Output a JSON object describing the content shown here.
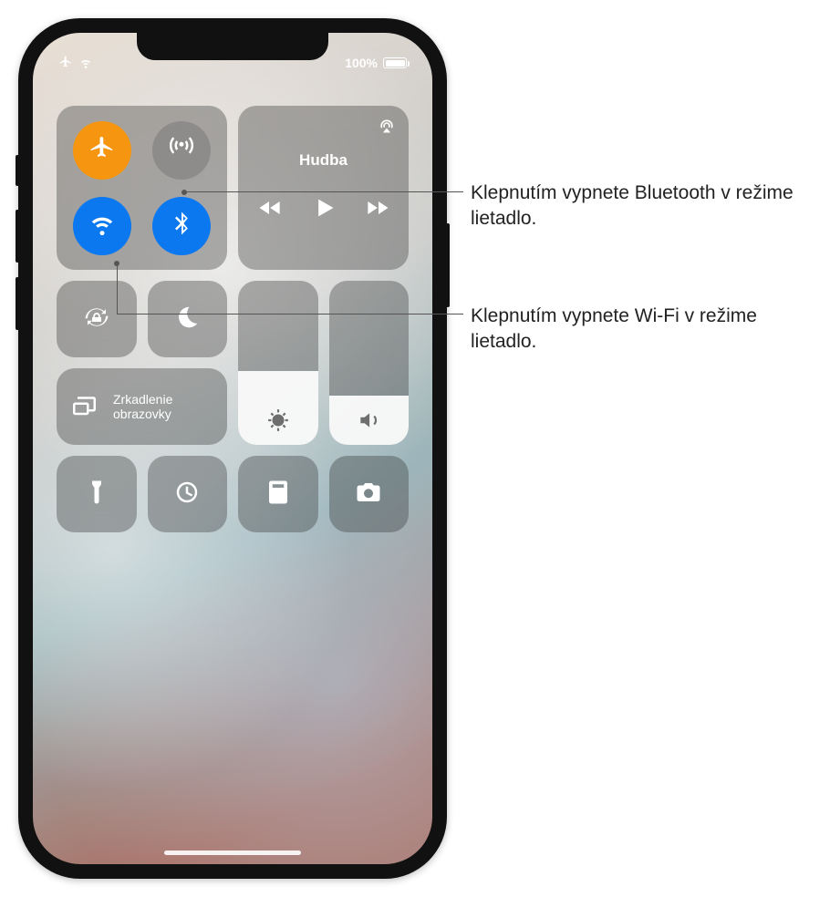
{
  "status": {
    "battery_pct": "100%"
  },
  "connectivity": {
    "airplane": {
      "name": "airplane-mode",
      "active": true
    },
    "cellular": {
      "name": "cellular-data",
      "active": false
    },
    "wifi": {
      "name": "wifi",
      "active": true
    },
    "bluetooth": {
      "name": "bluetooth",
      "active": true
    }
  },
  "music": {
    "title": "Hudba"
  },
  "screen_mirroring": {
    "label": "Zrkadlenie\nobrazovky"
  },
  "sliders": {
    "brightness_pct": 45,
    "volume_pct": 30
  },
  "shortcuts": {
    "orientation_lock": "orientation-lock",
    "do_not_disturb": "do-not-disturb",
    "flashlight": "flashlight",
    "timer": "timer",
    "calculator": "calculator",
    "camera": "camera"
  },
  "callouts": {
    "bluetooth": "Klepnutím vypnete Bluetooth v režime lietadlo.",
    "wifi": "Klepnutím vypnete Wi-Fi v režime lietadlo."
  }
}
